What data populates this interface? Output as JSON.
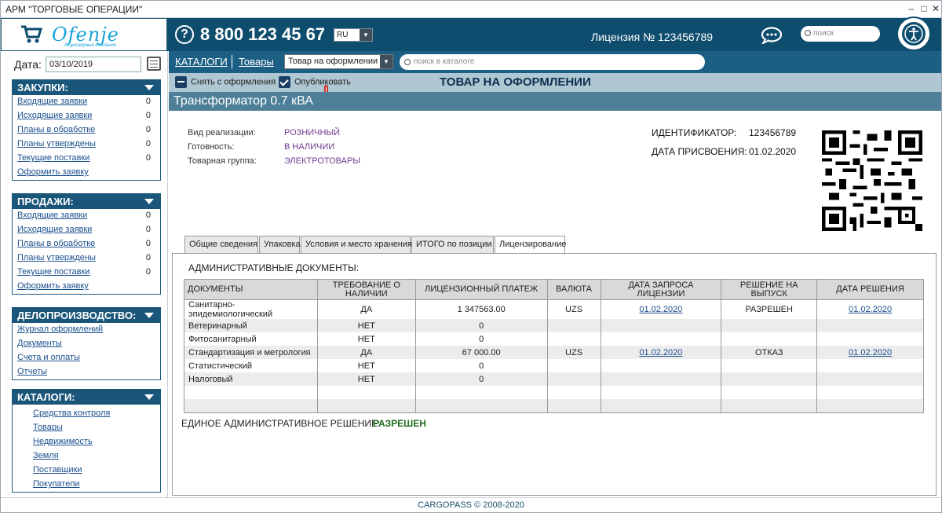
{
  "window": {
    "title": "АРМ \"ТОРГОВЫЕ ОПЕРАЦИИ\""
  },
  "header": {
    "logo_text": "Ofenje",
    "logo_sub": "Акционерные компания",
    "phone": "8 800 123 45 67",
    "lang": "RU",
    "license": "Лицензия № 123456789",
    "search_placeholder": "поиск"
  },
  "sidebar": {
    "date_label": "Дата:",
    "date_value": "03/10/2019",
    "purchases": {
      "title": "ЗАКУПКИ:",
      "items": [
        {
          "label": "Входящие заявки",
          "count": "0"
        },
        {
          "label": "Исходящие заявки",
          "count": "0"
        },
        {
          "label": "Планы в обработке",
          "count": "0"
        },
        {
          "label": "Планы утверждены",
          "count": "0"
        },
        {
          "label": "Текущие поставки",
          "count": "0"
        },
        {
          "label": "Оформить заявку",
          "count": ""
        }
      ]
    },
    "sales": {
      "title": "ПРОДАЖИ:",
      "items": [
        {
          "label": "Входящие заявки",
          "count": "0"
        },
        {
          "label": "Исходящие заявки",
          "count": "0"
        },
        {
          "label": "Планы в обработке",
          "count": "0"
        },
        {
          "label": "Планы утверждены",
          "count": "0"
        },
        {
          "label": "Текущие поставки",
          "count": "0"
        },
        {
          "label": "Оформить заявку",
          "count": ""
        }
      ]
    },
    "records": {
      "title": "ДЕЛОПРОИЗВОДСТВО:",
      "items": [
        {
          "label": "Журнал оформлений"
        },
        {
          "label": "Документы"
        },
        {
          "label": "Счета и оплаты"
        },
        {
          "label": "Отчеты"
        }
      ]
    },
    "catalogs": {
      "title": "КАТАЛОГИ:",
      "items": [
        {
          "label": "Средства контроля"
        },
        {
          "label": "Товары"
        },
        {
          "label": "Недвижимость"
        },
        {
          "label": "Земля"
        },
        {
          "label": "Поставщики"
        },
        {
          "label": "Покупатели"
        }
      ]
    }
  },
  "nav": {
    "catalogs": "КАТАЛОГИ",
    "goods": "Товары",
    "select_value": "Товар на оформлении",
    "search_placeholder": "поиск в каталоге"
  },
  "actions": {
    "unlist": "Снять с оформления",
    "publish": "Опубликовать",
    "status_title": "ТОВАР НА ОФОРМЛЕНИИ"
  },
  "product": {
    "name": "Трансформатор 0.7 кВА",
    "fields": [
      {
        "key": "Вид реализации:",
        "value": "РОЗНИЧНЫЙ"
      },
      {
        "key": "Готовность:",
        "value": "В НАЛИЧИИ"
      },
      {
        "key": "Товарная группа:",
        "value": "ЭЛЕКТРОТОВАРЫ"
      }
    ],
    "id_label": "ИДЕНТИФИКАТОР:",
    "id_value": "123456789",
    "date_label": "ДАТА ПРИСВОЕНИЯ:",
    "date_value": "01.02.2020"
  },
  "tabs": [
    {
      "label": "Общие сведения"
    },
    {
      "label": "Упаковка"
    },
    {
      "label": "Условия и место хранения"
    },
    {
      "label": "ИТОГО по позиции"
    },
    {
      "label": "Лицензирование"
    }
  ],
  "licensing": {
    "section_title": "АДМИНИСТРАТИВНЫЕ ДОКУМЕНТЫ:",
    "columns": [
      "ДОКУМЕНТЫ",
      "ТРЕБОВАНИЕ О НАЛИЧИИ",
      "ЛИЦЕНЗИОННЫЙ ПЛАТЕЖ",
      "ВАЛЮТА",
      "ДАТА ЗАПРОСА ЛИЦЕНЗИИ",
      "РЕШЕНИЕ НА ВЫПУСК",
      "ДАТА РЕШЕНИЯ"
    ],
    "rows": [
      {
        "doc": "Санитарно-эпидемиологический",
        "req": "ДА",
        "fee": "1 347563.00",
        "cur": "UZS",
        "req_date": "01.02.2020",
        "decision": "РАЗРЕШЕН",
        "dec_date": "01.02.2020"
      },
      {
        "doc": "Ветеринарный",
        "req": "НЕТ",
        "fee": "0",
        "cur": "",
        "req_date": "",
        "decision": "",
        "dec_date": ""
      },
      {
        "doc": "Фитосанитарный",
        "req": "НЕТ",
        "fee": "0",
        "cur": "",
        "req_date": "",
        "decision": "",
        "dec_date": ""
      },
      {
        "doc": "Стандартизация и метрология",
        "req": "ДА",
        "fee": "67 000.00",
        "cur": "UZS",
        "req_date": "01.02.2020",
        "decision": "ОТКАЗ",
        "dec_date": "01.02.2020"
      },
      {
        "doc": "Статистический",
        "req": "НЕТ",
        "fee": "0",
        "cur": "",
        "req_date": "",
        "decision": "",
        "dec_date": ""
      },
      {
        "doc": "Налоговый",
        "req": "НЕТ",
        "fee": "0",
        "cur": "",
        "req_date": "",
        "decision": "",
        "dec_date": ""
      },
      {
        "doc": "",
        "req": "",
        "fee": "",
        "cur": "",
        "req_date": "",
        "decision": "",
        "dec_date": ""
      },
      {
        "doc": "",
        "req": "",
        "fee": "",
        "cur": "",
        "req_date": "",
        "decision": "",
        "dec_date": ""
      }
    ],
    "single_decision_label": "ЕДИНОЕ АДМИНИСТРАТИВНОЕ РЕШЕНИЕ:",
    "single_decision_value": "РАЗРЕШЕН"
  },
  "footer": {
    "text": "CARGOPASS © 2008-2020"
  }
}
